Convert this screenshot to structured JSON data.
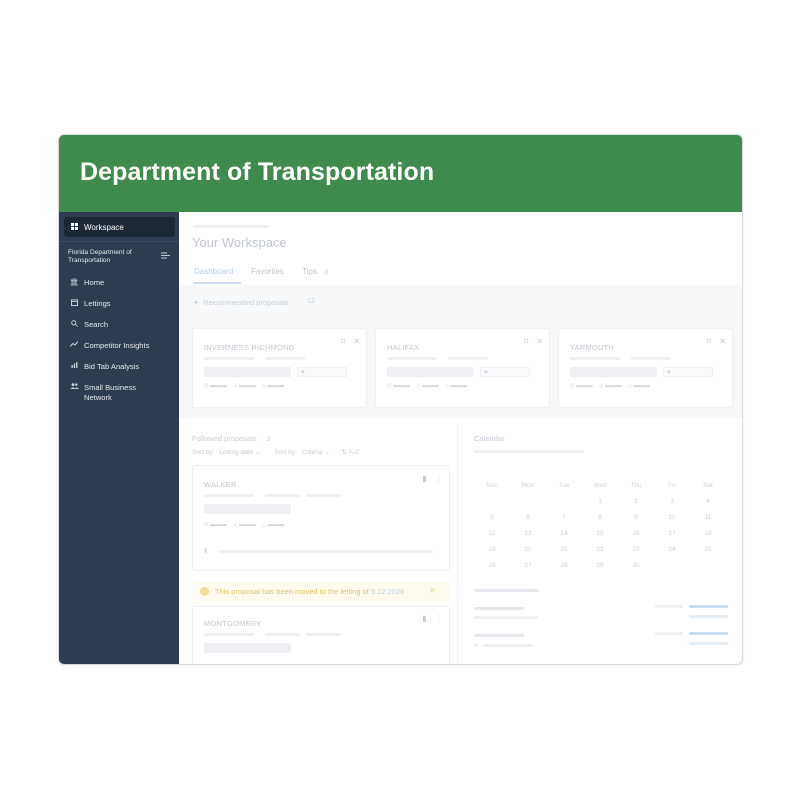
{
  "header": {
    "title": "Department of Transportation"
  },
  "sidebar": {
    "active_item": {
      "label": "Workspace",
      "icon": "grid-icon"
    },
    "org": {
      "name": "Florida Department of Transportation",
      "collapse_icon": "collapse-menu-icon"
    },
    "items": [
      {
        "label": "Home",
        "icon": "bank-icon"
      },
      {
        "label": "Lettings",
        "icon": "calendar-icon"
      },
      {
        "label": "Search",
        "icon": "search-icon"
      },
      {
        "label": "Competitor Insights",
        "icon": "trend-icon"
      },
      {
        "label": "Bid Tab Analysis",
        "icon": "bar-chart-icon"
      },
      {
        "label": "Small Business Network",
        "icon": "people-icon"
      }
    ]
  },
  "main": {
    "title": "Your Workspace",
    "tabs": [
      {
        "label": "Dashboard",
        "active": true
      },
      {
        "label": "Favorites",
        "active": false
      },
      {
        "label": "Tips",
        "active": false,
        "count": "3"
      }
    ],
    "recommended": {
      "label": "Recommended proposals",
      "count": "12",
      "cards": [
        {
          "name": "INVERNESS RICHMOND"
        },
        {
          "name": "HALIFAX"
        },
        {
          "name": "YARMOUTH"
        }
      ]
    },
    "followed": {
      "label": "Followed proposals",
      "count": "3",
      "sort_label": "Sort by:",
      "sort_value": "Letting date",
      "sort2_label": "Sort by:",
      "sort2_value": "Criteria",
      "az_label": "A-Z",
      "cards": [
        {
          "name": "WALKER"
        },
        {
          "name": "MONTGOMERY"
        }
      ],
      "notice": {
        "text": "This proposal has been moved to the letting of",
        "date": "5.12.2026"
      }
    },
    "calendar": {
      "label": "Calendar",
      "weekdays": [
        "Sun",
        "Mon",
        "Tue",
        "Wed",
        "Thu",
        "Fri",
        "Sat"
      ],
      "days": [
        [
          "",
          "",
          "",
          "1",
          "2",
          "3",
          "4"
        ],
        [
          "5",
          "6",
          "7",
          "8",
          "9",
          "10",
          "11"
        ],
        [
          "12",
          "13",
          "14",
          "15",
          "16",
          "17",
          "18"
        ],
        [
          "19",
          "20",
          "21",
          "22",
          "23",
          "24",
          "25"
        ],
        [
          "26",
          "27",
          "28",
          "29",
          "30",
          "",
          ""
        ]
      ]
    }
  },
  "colors": {
    "banner": "#3f8a4d",
    "sidebar": "#2d3c4e",
    "sidebar_active": "#1d2836",
    "accent_blue": "#bcd2ec"
  }
}
